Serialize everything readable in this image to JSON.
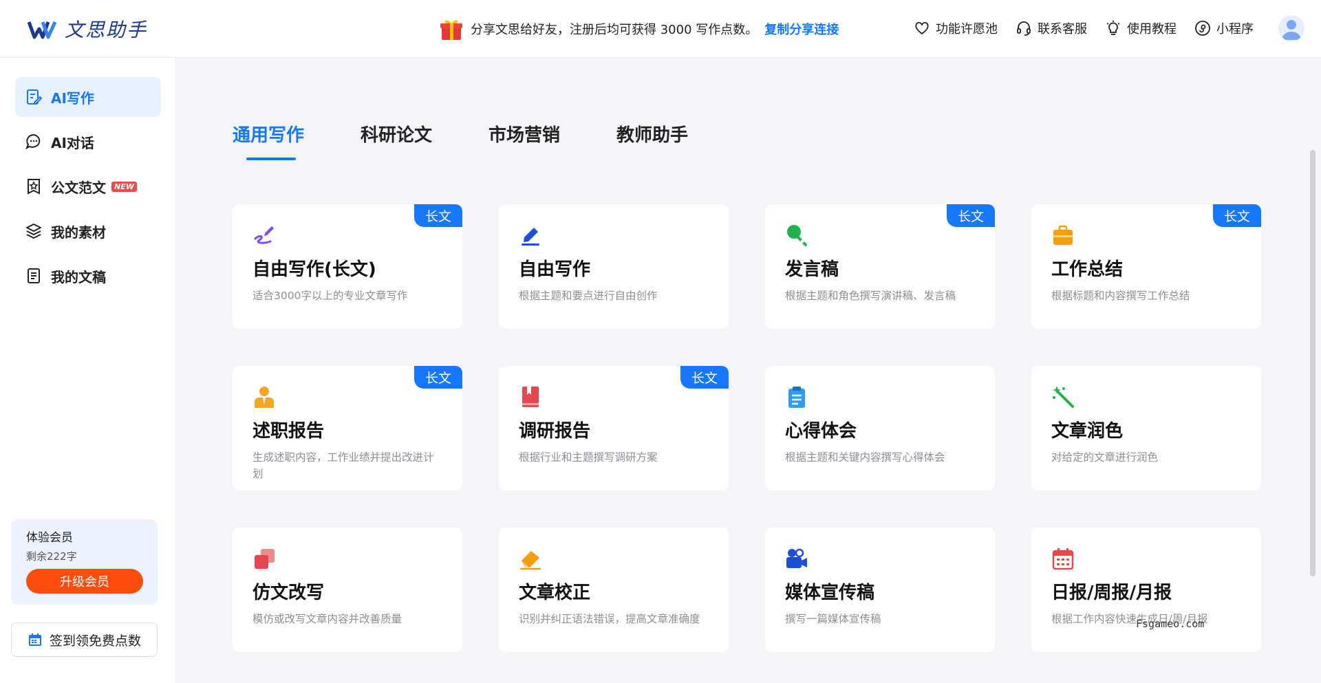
{
  "brand": {
    "name": "文思助手",
    "accent": "#1677ff"
  },
  "header": {
    "promo_text": "分享文思给好友，注册后均可获得 3000 写作点数。",
    "promo_link": "复制分享连接",
    "links": [
      {
        "label": "功能许愿池",
        "icon": "heart-icon"
      },
      {
        "label": "联系客服",
        "icon": "headset-icon"
      },
      {
        "label": "使用教程",
        "icon": "lightbulb-icon"
      },
      {
        "label": "小程序",
        "icon": "mini-program-icon"
      }
    ]
  },
  "sidebar": {
    "items": [
      {
        "label": "AI写作",
        "icon": "edit-document-icon",
        "active": true
      },
      {
        "label": "AI对话",
        "icon": "chat-bubble-icon"
      },
      {
        "label": "公文范文",
        "icon": "badge-star-icon",
        "badge": "NEW"
      },
      {
        "label": "我的素材",
        "icon": "layers-icon"
      },
      {
        "label": "我的文稿",
        "icon": "document-icon"
      }
    ],
    "member": {
      "title": "体验会员",
      "remaining": "剩余222字",
      "upgrade": "升级会员"
    },
    "signin": "签到领免费点数"
  },
  "tabs": [
    {
      "label": "通用写作",
      "active": true
    },
    {
      "label": "科研论文"
    },
    {
      "label": "市场营销"
    },
    {
      "label": "教师助手"
    }
  ],
  "long_badge": "长文",
  "cards": [
    {
      "title": "自由写作(长文)",
      "desc": "适合3000字以上的专业文章写作",
      "long": true,
      "icon": "pen-scribble-icon",
      "color": "#7b4dff"
    },
    {
      "title": "自由写作",
      "desc": "根据主题和要点进行自由创作",
      "long": false,
      "icon": "pen-icon",
      "color": "#1d4ed8"
    },
    {
      "title": "发言稿",
      "desc": "根据主题和角色撰写演讲稿、发言稿",
      "long": true,
      "icon": "microphone-icon",
      "color": "#22b14c"
    },
    {
      "title": "工作总结",
      "desc": "根据标题和内容撰写工作总结",
      "long": true,
      "icon": "briefcase-icon",
      "color": "#f59e0b"
    },
    {
      "title": "述职报告",
      "desc": "生成述职内容，工作业绩并提出改进计划",
      "long": true,
      "icon": "person-tie-icon",
      "color": "#f5a623"
    },
    {
      "title": "调研报告",
      "desc": "根据行业和主题撰写调研方案",
      "long": true,
      "icon": "book-icon",
      "color": "#e5484d"
    },
    {
      "title": "心得体会",
      "desc": "根据主题和关键内容撰写心得体会",
      "long": false,
      "icon": "clipboard-icon",
      "color": "#2f9bf4"
    },
    {
      "title": "文章润色",
      "desc": "对给定的文章进行润色",
      "long": false,
      "icon": "magic-wand-icon",
      "color": "#22b14c"
    },
    {
      "title": "仿文改写",
      "desc": "模仿或改写文章内容并改善质量",
      "long": false,
      "icon": "copy-cards-icon",
      "color": "#e5484d"
    },
    {
      "title": "文章校正",
      "desc": "识别并纠正语法错误，提高文章准确度",
      "long": false,
      "icon": "eraser-icon",
      "color": "#f59e0b"
    },
    {
      "title": "媒体宣传稿",
      "desc": "撰写一篇媒体宣传稿",
      "long": false,
      "icon": "video-camera-icon",
      "color": "#1d4ed8"
    },
    {
      "title": "日报/周报/月报",
      "desc": "根据工作内容快速生成日/周/月报",
      "long": false,
      "icon": "calendar-icon",
      "color": "#e5484d"
    }
  ],
  "watermark": "Fsgameo.com"
}
